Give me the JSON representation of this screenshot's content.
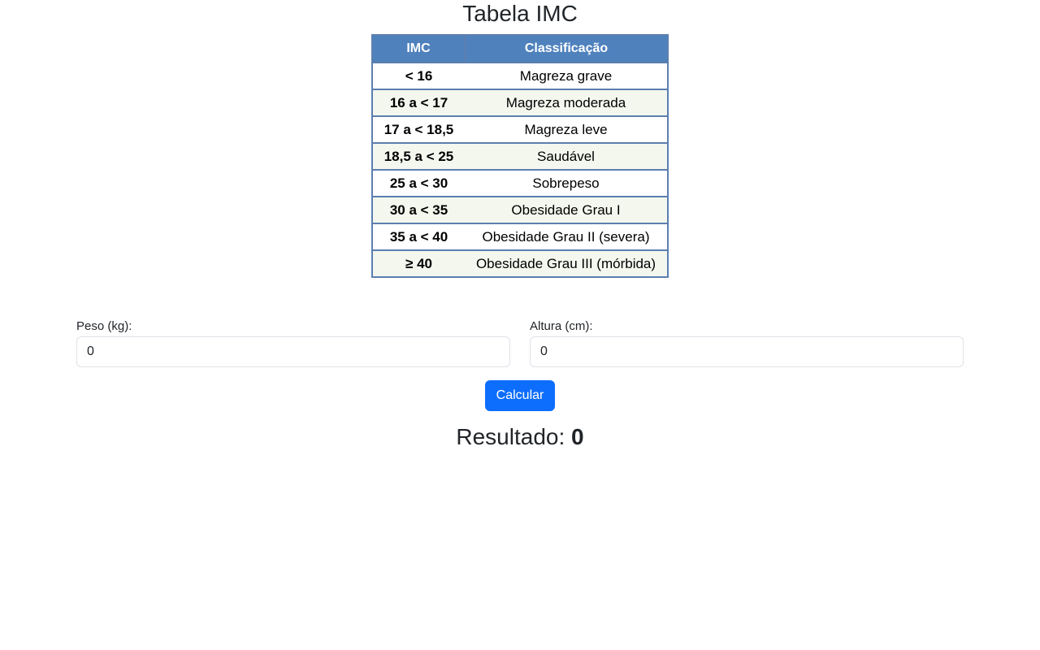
{
  "page": {
    "title": "Tabela IMC"
  },
  "imc_table": {
    "headers": {
      "imc": "IMC",
      "classification": "Classificação"
    },
    "rows": [
      {
        "range": "< 16",
        "classification": "Magreza grave"
      },
      {
        "range": "16 a < 17",
        "classification": "Magreza moderada"
      },
      {
        "range": "17 a < 18,5",
        "classification": "Magreza leve"
      },
      {
        "range": "18,5 a < 25",
        "classification": "Saudável"
      },
      {
        "range": "25 a < 30",
        "classification": "Sobrepeso"
      },
      {
        "range": "30 a < 35",
        "classification": "Obesidade Grau I"
      },
      {
        "range": "35 a < 40",
        "classification": "Obesidade Grau II (severa)"
      },
      {
        "range": "≥ 40",
        "classification": "Obesidade Grau III (mórbida)"
      }
    ],
    "colors": {
      "header_bg": "#4f81bd",
      "border": "#5b7fb0"
    }
  },
  "form": {
    "peso": {
      "label": "Peso (kg):",
      "value": "0"
    },
    "altura": {
      "label": "Altura (cm):",
      "value": "0"
    },
    "calculate_label": "Calcular"
  },
  "result": {
    "label": "Resultado:",
    "value": "0"
  },
  "colors": {
    "primary_button": "#0d6efd"
  }
}
